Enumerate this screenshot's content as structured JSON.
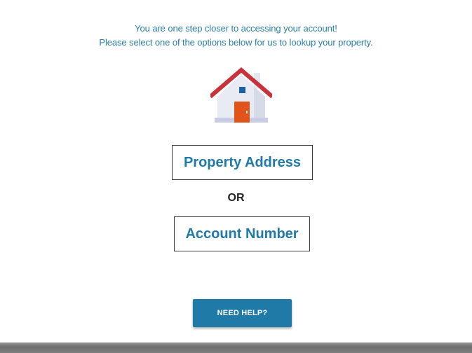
{
  "intro": {
    "line1": "You are one step closer to accessing your account!",
    "line2": "Please select one of the options below for us to lookup your property."
  },
  "icons": {
    "house": "house-icon"
  },
  "colors": {
    "accent": "#1f7aa8",
    "roof": "#c8323a",
    "door": "#e2521b",
    "window": "#1f5fa6"
  },
  "options": {
    "address_label": "Property Address",
    "separator": "OR",
    "account_label": "Account Number"
  },
  "help": {
    "label": "NEED HELP?"
  }
}
